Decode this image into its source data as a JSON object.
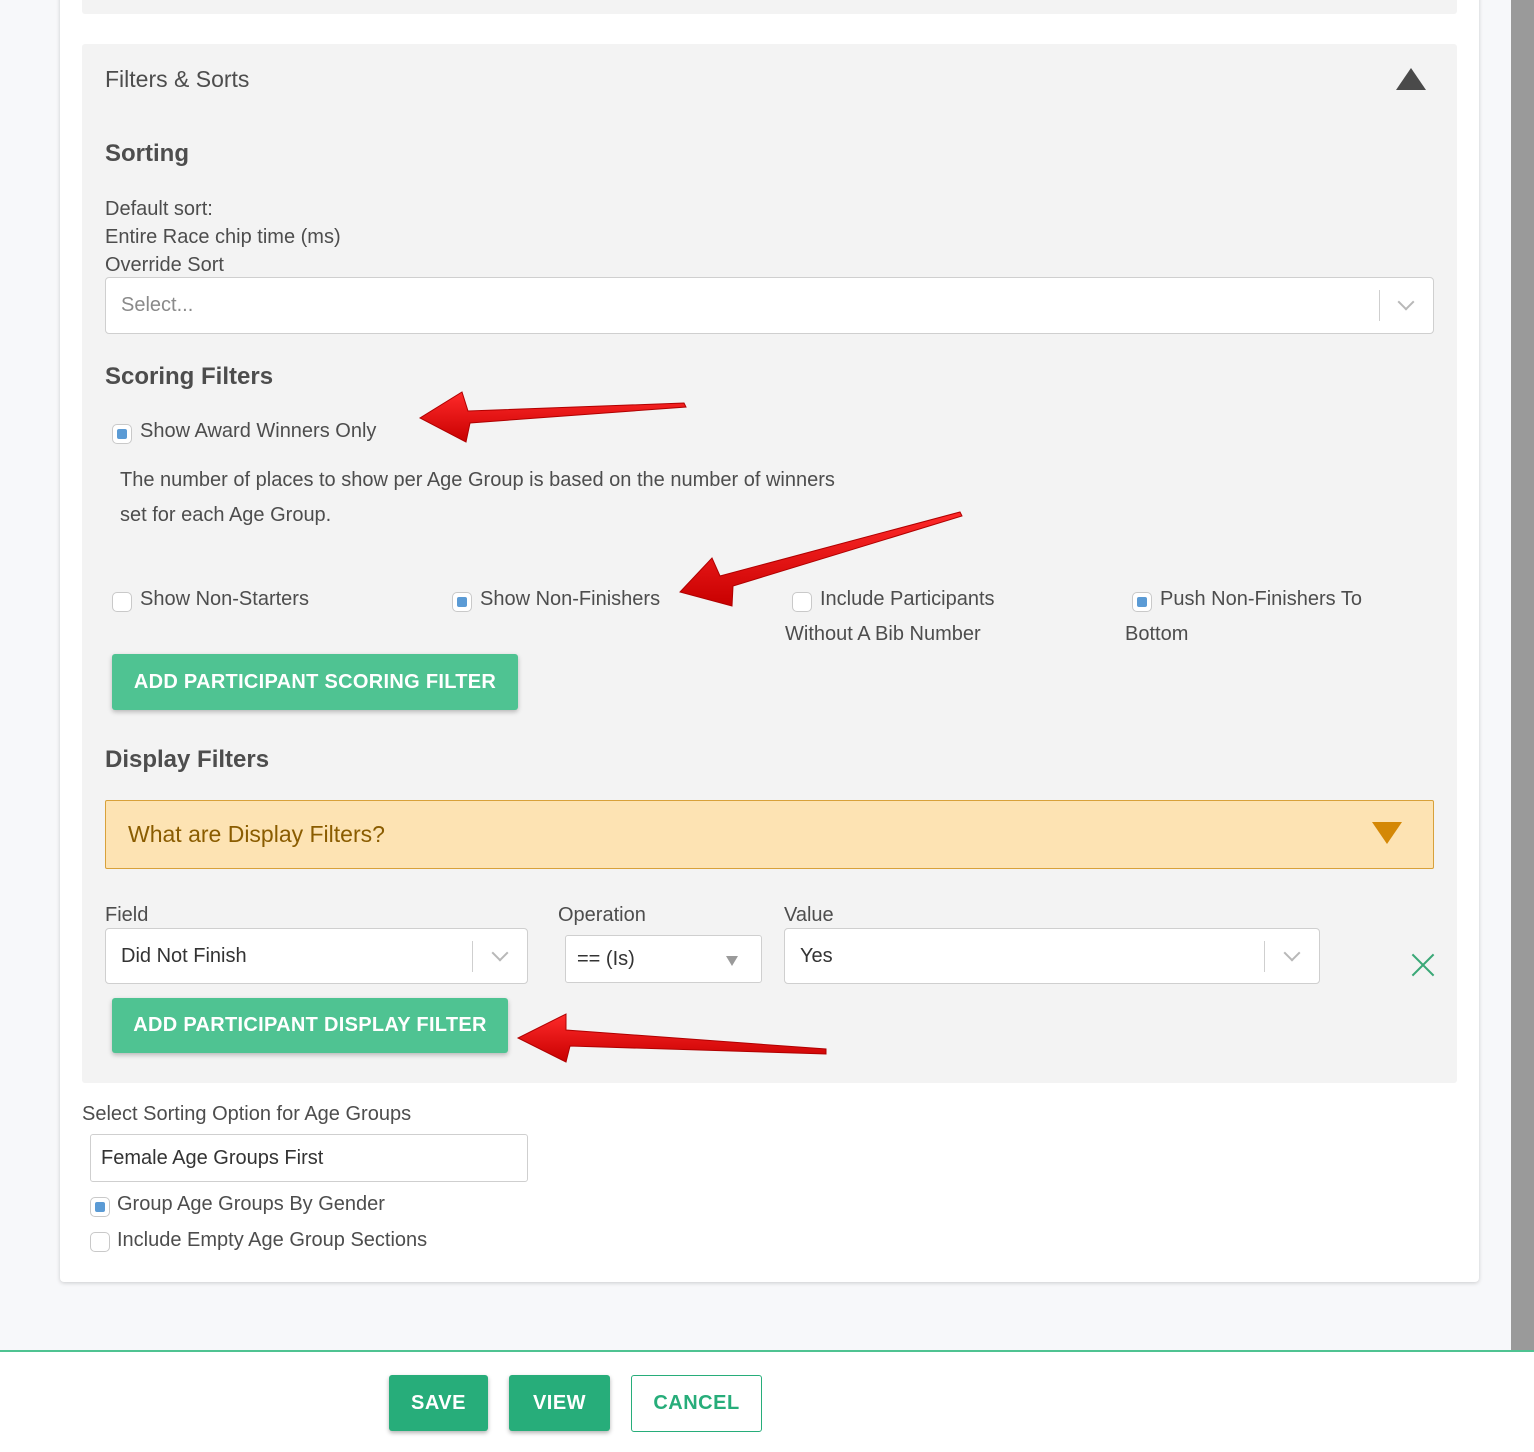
{
  "panel": {
    "title": "Filters & Sorts"
  },
  "sorting": {
    "heading": "Sorting",
    "default_sort_label": "Default sort:",
    "default_sort_value": "Entire Race chip time (ms)",
    "override_label": "Override Sort",
    "override_placeholder": "Select..."
  },
  "scoring_filters": {
    "heading": "Scoring Filters",
    "award_winners_label": "Show Award Winners Only",
    "award_winners_checked": true,
    "help_line1": "The number of places to show per Age Group is based on the number of winners",
    "help_line2": "set for each Age Group.",
    "options": [
      {
        "label_line1": "Show Non-Starters",
        "label_line2": "",
        "checked": false
      },
      {
        "label_line1": "Show Non-Finishers",
        "label_line2": "",
        "checked": true
      },
      {
        "label_line1": "Include Participants",
        "label_line2": "Without A Bib Number",
        "checked": false
      },
      {
        "label_line1": "Push Non-Finishers To",
        "label_line2": "Bottom",
        "checked": true
      }
    ],
    "add_button": "ADD PARTICIPANT SCORING FILTER"
  },
  "display_filters": {
    "heading": "Display Filters",
    "info_title": "What are Display Filters?",
    "field_label": "Field",
    "field_value": "Did Not Finish",
    "operation_label": "Operation",
    "operation_value": "== (Is)",
    "value_label": "Value",
    "value_value": "Yes",
    "add_button": "ADD PARTICIPANT DISPLAY FILTER"
  },
  "age_groups": {
    "sort_label": "Select Sorting Option for Age Groups",
    "sort_value": "Female Age Groups First",
    "group_by_gender_label": "Group Age Groups By Gender",
    "group_by_gender_checked": true,
    "include_empty_label": "Include Empty Age Group Sections",
    "include_empty_checked": false
  },
  "footer": {
    "save": "SAVE",
    "view": "VIEW",
    "cancel": "CANCEL"
  },
  "colors": {
    "accent_green": "#4fc392",
    "footer_green": "#27ad7a",
    "info_bg": "#fde3b3",
    "info_text": "#8a5c00",
    "annotation_red": "#e01010"
  }
}
